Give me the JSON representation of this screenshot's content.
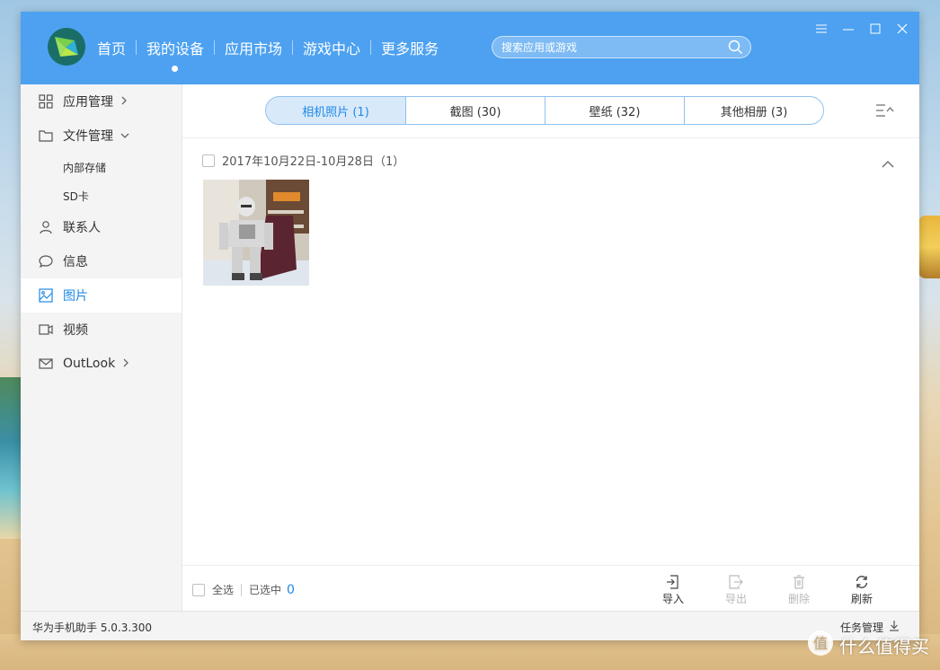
{
  "app": {
    "nav": [
      {
        "label": "首页",
        "active": false
      },
      {
        "label": "我的设备",
        "active": true
      },
      {
        "label": "应用市场",
        "active": false
      },
      {
        "label": "游戏中心",
        "active": false
      },
      {
        "label": "更多服务",
        "active": false
      }
    ],
    "search_placeholder": "搜索应用或游戏",
    "accent_color": "#4da1f0",
    "highlight_color": "#1e88e5"
  },
  "sidebar": {
    "items": [
      {
        "label": "应用管理",
        "icon": "grid-icon",
        "chevron": "right"
      },
      {
        "label": "文件管理",
        "icon": "folder-icon",
        "chevron": "down"
      },
      {
        "label": "内部存储",
        "sub": true
      },
      {
        "label": "SD卡",
        "sub": true
      },
      {
        "label": "联系人",
        "icon": "person-icon"
      },
      {
        "label": "信息",
        "icon": "chat-icon"
      },
      {
        "label": "图片",
        "icon": "image-icon",
        "active": true
      },
      {
        "label": "视频",
        "icon": "video-icon"
      },
      {
        "label": "OutLook",
        "icon": "mail-icon",
        "chevron": "right"
      }
    ]
  },
  "gallery": {
    "tabs": [
      {
        "label": "相机照片 (1)",
        "active": true
      },
      {
        "label": "截图 (30)",
        "active": false
      },
      {
        "label": "壁纸 (32)",
        "active": false
      },
      {
        "label": "其他相册 (3)",
        "active": false
      }
    ],
    "group_label": "2017年10月22日-10月28日（1）"
  },
  "footer": {
    "select_all": "全选",
    "selected_label": "已选中",
    "selected_count": "0",
    "actions": [
      {
        "label": "导入",
        "icon": "import-icon",
        "enabled": true
      },
      {
        "label": "导出",
        "icon": "export-icon",
        "enabled": false
      },
      {
        "label": "删除",
        "icon": "trash-icon",
        "enabled": false
      },
      {
        "label": "刷新",
        "icon": "refresh-icon",
        "enabled": true
      }
    ]
  },
  "status": {
    "version": "华为手机助手 5.0.3.300",
    "task_manager": "任务管理"
  },
  "watermark": {
    "text": "什么值得买"
  }
}
